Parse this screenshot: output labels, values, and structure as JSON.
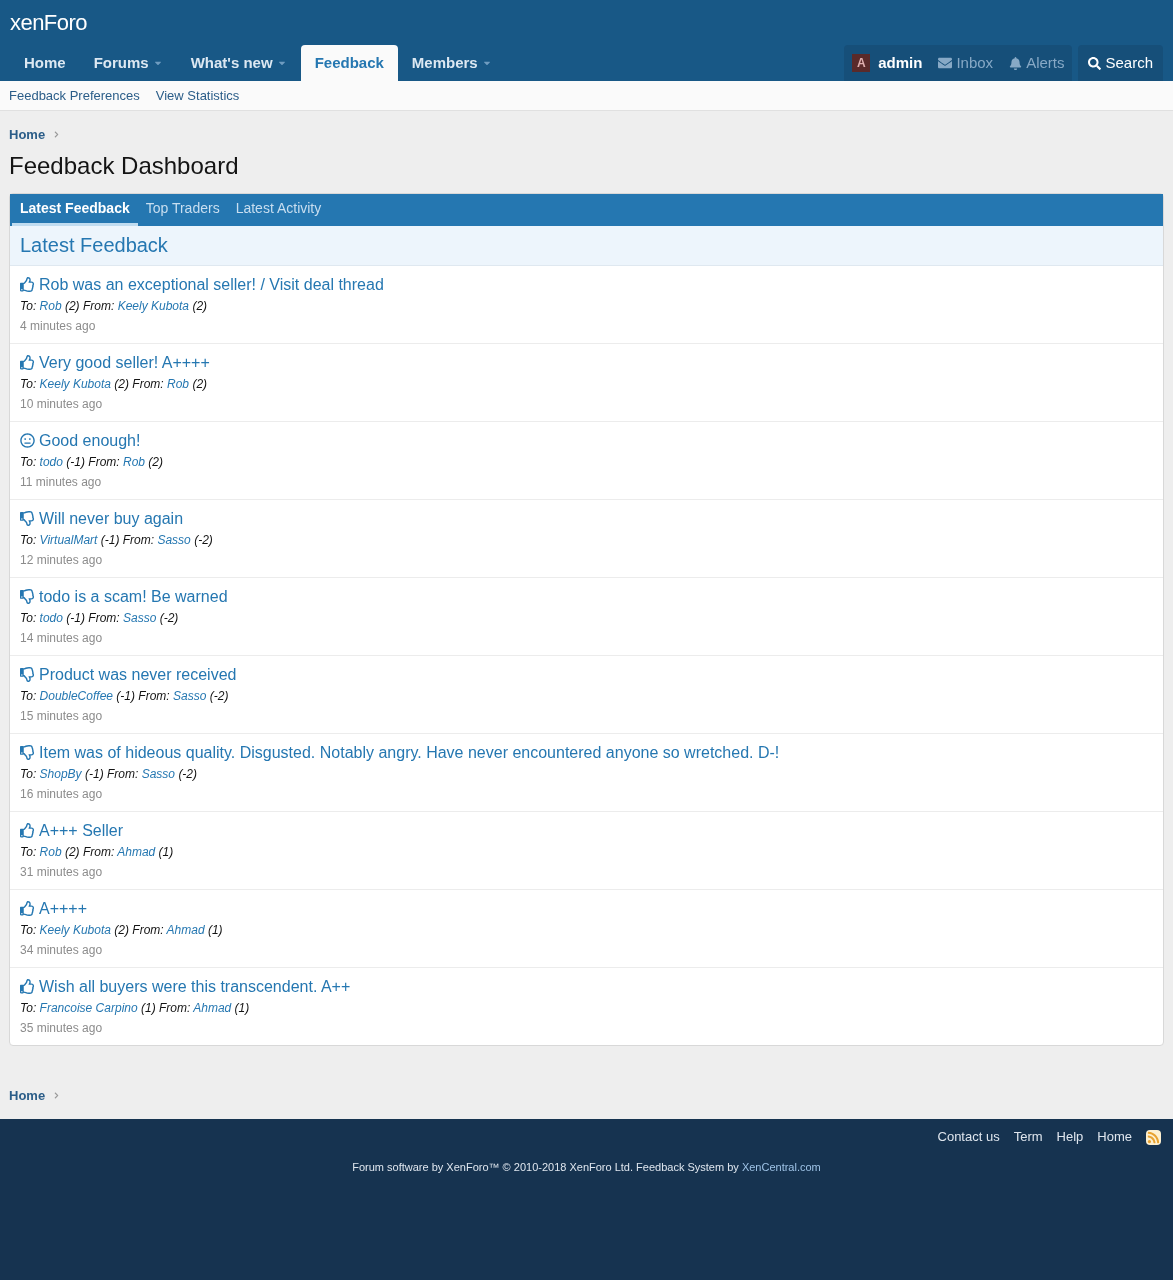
{
  "logo": "xenForo",
  "nav": [
    {
      "label": "Home",
      "selected": false,
      "dropdown": false
    },
    {
      "label": "Forums",
      "selected": false,
      "dropdown": true
    },
    {
      "label": "What's new",
      "selected": false,
      "dropdown": true
    },
    {
      "label": "Feedback",
      "selected": true,
      "dropdown": false
    },
    {
      "label": "Members",
      "selected": false,
      "dropdown": true
    }
  ],
  "user": {
    "avatar": "A",
    "name": "admin",
    "inbox": "Inbox",
    "alerts": "Alerts"
  },
  "search": "Search",
  "subnav": [
    "Feedback Preferences",
    "View Statistics"
  ],
  "breadcrumb": "Home",
  "title": "Feedback Dashboard",
  "tabs": [
    {
      "label": "Latest Feedback",
      "selected": true
    },
    {
      "label": "Top Traders",
      "selected": false
    },
    {
      "label": "Latest Activity",
      "selected": false
    }
  ],
  "section_title": "Latest Feedback",
  "items": [
    {
      "kind": "positive",
      "title": "Rob was an exceptional seller! / Visit deal thread",
      "to": {
        "label": "To:",
        "name": "Rob",
        "score": "(2)"
      },
      "from": {
        "label": "From:",
        "name": "Keely Kubota",
        "score": "(2)"
      },
      "time": "4 minutes ago"
    },
    {
      "kind": "positive",
      "title": "Very good seller! A++++",
      "to": {
        "label": "To:",
        "name": "Keely Kubota",
        "score": "(2)"
      },
      "from": {
        "label": "From:",
        "name": "Rob",
        "score": "(2)"
      },
      "time": "10 minutes ago"
    },
    {
      "kind": "neutral",
      "title": "Good enough!",
      "to": {
        "label": "To:",
        "name": "todo",
        "score": "(-1)"
      },
      "from": {
        "label": "From:",
        "name": "Rob",
        "score": "(2)"
      },
      "time": "11 minutes ago"
    },
    {
      "kind": "negative",
      "title": "Will never buy again",
      "to": {
        "label": "To:",
        "name": "VirtualMart",
        "score": "(-1)"
      },
      "from": {
        "label": "From:",
        "name": "Sasso",
        "score": "(-2)"
      },
      "time": "12 minutes ago"
    },
    {
      "kind": "negative",
      "title": "todo is a scam! Be warned",
      "to": {
        "label": "To:",
        "name": "todo",
        "score": "(-1)"
      },
      "from": {
        "label": "From:",
        "name": "Sasso",
        "score": "(-2)"
      },
      "time": "14 minutes ago"
    },
    {
      "kind": "negative",
      "title": "Product was never received",
      "to": {
        "label": "To:",
        "name": "DoubleCoffee",
        "score": "(-1)"
      },
      "from": {
        "label": "From:",
        "name": "Sasso",
        "score": "(-2)"
      },
      "time": "15 minutes ago"
    },
    {
      "kind": "negative",
      "title": "Item was of hideous quality. Disgusted. Notably angry. Have never encountered anyone so wretched. D-!",
      "to": {
        "label": "To:",
        "name": "ShopBy",
        "score": "(-1)"
      },
      "from": {
        "label": "From:",
        "name": "Sasso",
        "score": "(-2)"
      },
      "time": "16 minutes ago"
    },
    {
      "kind": "positive",
      "title": "A+++ Seller",
      "to": {
        "label": "To:",
        "name": "Rob",
        "score": "(2)"
      },
      "from": {
        "label": "From:",
        "name": "Ahmad",
        "score": "(1)"
      },
      "time": "31 minutes ago"
    },
    {
      "kind": "positive",
      "title": "A++++",
      "to": {
        "label": "To:",
        "name": "Keely Kubota",
        "score": "(2)"
      },
      "from": {
        "label": "From:",
        "name": "Ahmad",
        "score": "(1)"
      },
      "time": "34 minutes ago"
    },
    {
      "kind": "positive",
      "title": "Wish all buyers were this transcendent. A++",
      "to": {
        "label": "To:",
        "name": "Francoise Carpino",
        "score": "(1)"
      },
      "from": {
        "label": "From:",
        "name": "Ahmad",
        "score": "(1)"
      },
      "time": "35 minutes ago"
    }
  ],
  "bottom_breadcrumb": "Home",
  "footer_links": [
    "Contact us",
    "Term",
    "Help",
    "Home"
  ],
  "copyright": "Forum software by XenForo™ © 2010-2018 XenForo Ltd. Feedback System by",
  "copyright_link": "XenCentral.com"
}
